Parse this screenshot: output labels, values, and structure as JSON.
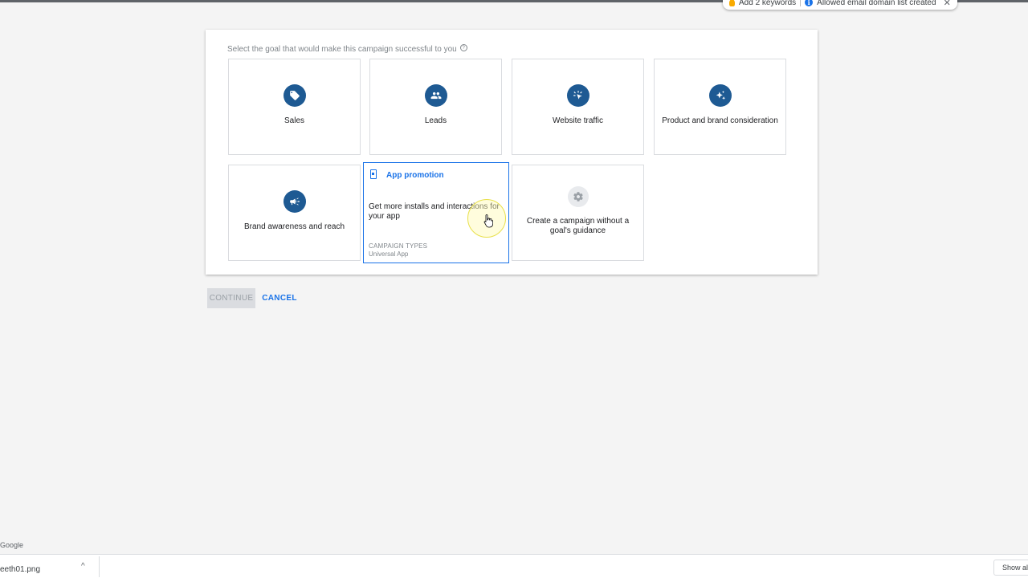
{
  "notifications": {
    "keywords_label": "Add 2 keywords",
    "domain_label": "Allowed email domain list created",
    "close_glyph": "✕"
  },
  "goal_prompt": "Select the goal that would make this campaign successful to you",
  "goals": {
    "sales": {
      "label": "Sales",
      "icon": "tag-icon"
    },
    "leads": {
      "label": "Leads",
      "icon": "people-icon"
    },
    "website_traffic": {
      "label": "Website traffic",
      "icon": "cursor-click-icon"
    },
    "product_brand": {
      "label": "Product and brand consideration",
      "icon": "sparkle-icon"
    },
    "brand_awareness": {
      "label": "Brand awareness and reach",
      "icon": "megaphone-icon"
    },
    "no_goal": {
      "label": "Create a campaign without a goal's guidance",
      "icon": "gear-icon"
    }
  },
  "app_promotion": {
    "title": "App promotion",
    "description": "Get more installs and interactions for your app",
    "campaign_types_label": "CAMPAIGN TYPES",
    "campaign_type": "Universal App",
    "icon": "phone-icon"
  },
  "actions": {
    "continue": "CONTINUE",
    "cancel": "CANCEL"
  },
  "footer": {
    "brand": "Google"
  },
  "download_bar": {
    "filename": "eeth01.png",
    "chevron": "^",
    "show_all": "Show all"
  },
  "colors": {
    "accent": "#1a73e8",
    "icon_bg": "#1e5a93",
    "page_bg": "#f4f4f4"
  }
}
